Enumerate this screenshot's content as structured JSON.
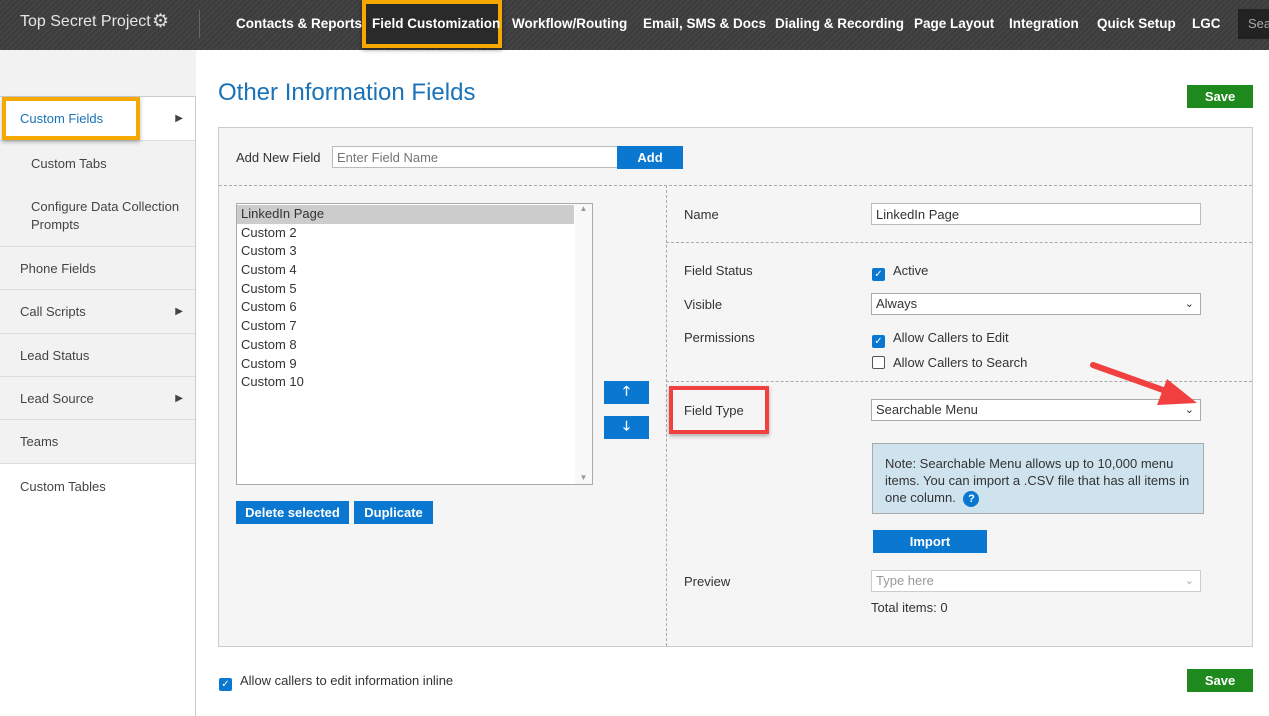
{
  "header": {
    "brand": "Top Secret Project",
    "search_placeholder": "Search",
    "nav": [
      "Contacts & Reports",
      "Field Customization",
      "Workflow/Routing",
      "Email, SMS & Docs",
      "Dialing & Recording",
      "Page Layout",
      "Integration",
      "Quick Setup",
      "LGC"
    ],
    "active_nav": "Field Customization"
  },
  "sidebar": {
    "items": [
      {
        "label": "Custom Fields",
        "active": true,
        "arrow": true
      },
      {
        "label": "Custom Tabs",
        "sub": true
      },
      {
        "label": "Configure Data Collection Prompts",
        "sub": true
      },
      {
        "label": "Phone Fields"
      },
      {
        "label": "Call Scripts",
        "arrow": true
      },
      {
        "label": "Lead Status"
      },
      {
        "label": "Lead Source",
        "arrow": true
      },
      {
        "label": "Teams"
      },
      {
        "label": "Custom Tables"
      }
    ]
  },
  "main": {
    "title": "Other Information Fields",
    "save_label": "Save",
    "add_field": {
      "label": "Add New Field",
      "placeholder": "Enter Field Name",
      "button": "Add"
    },
    "fields": [
      "LinkedIn Page",
      "Custom 2",
      "Custom 3",
      "Custom 4",
      "Custom 5",
      "Custom 6",
      "Custom 7",
      "Custom 8",
      "Custom 9",
      "Custom 10"
    ],
    "selected_field": "LinkedIn Page",
    "delete_label": "Delete selected",
    "duplicate_label": "Duplicate",
    "details": {
      "name_label": "Name",
      "name_value": "LinkedIn Page",
      "status_label": "Field Status",
      "status_value": "Active",
      "status_checked": true,
      "visible_label": "Visible",
      "visible_value": "Always",
      "permissions_label": "Permissions",
      "perm_edit": "Allow Callers to Edit",
      "perm_edit_checked": true,
      "perm_search": "Allow Callers to Search",
      "perm_search_checked": false,
      "type_label": "Field Type",
      "type_value": "Searchable Menu",
      "note": "Note: Searchable Menu allows up to 10,000 menu items. You can import a .CSV file that has all items in one column.",
      "import_label": "Import",
      "preview_label": "Preview",
      "preview_placeholder": "Type here",
      "total_items": "Total items: 0"
    },
    "inline_label": "Allow callers to edit information inline",
    "inline_checked": true
  },
  "colors": {
    "accent": "#0a78d0",
    "save": "#1e8a1e",
    "highlight": "#f5a800",
    "annotation": "#f04040"
  }
}
